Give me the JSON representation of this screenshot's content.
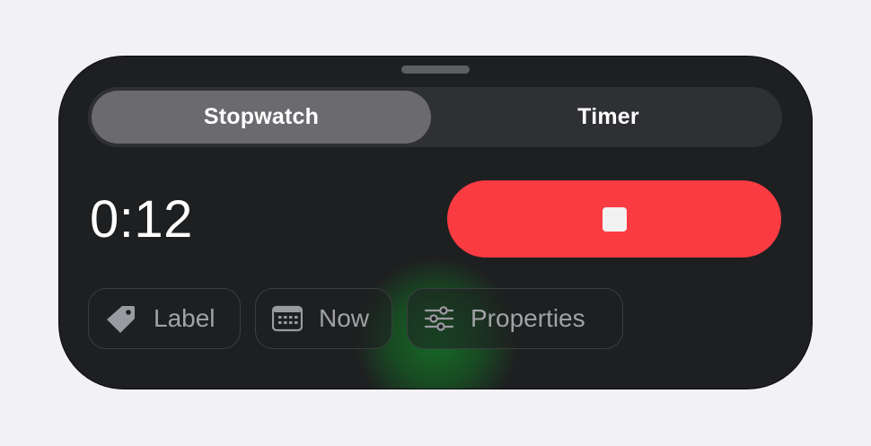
{
  "segmented": {
    "tabs": [
      {
        "label": "Stopwatch",
        "selected": true
      },
      {
        "label": "Timer",
        "selected": false
      }
    ]
  },
  "stopwatch": {
    "elapsed": "0:12",
    "stop_icon": "stop-icon",
    "stop_color": "#fb3b42"
  },
  "chips": {
    "label": {
      "text": "Label",
      "icon": "tag-icon"
    },
    "now": {
      "text": "Now",
      "icon": "calendar-icon"
    },
    "properties": {
      "text": "Properties",
      "icon": "sliders-icon"
    }
  }
}
